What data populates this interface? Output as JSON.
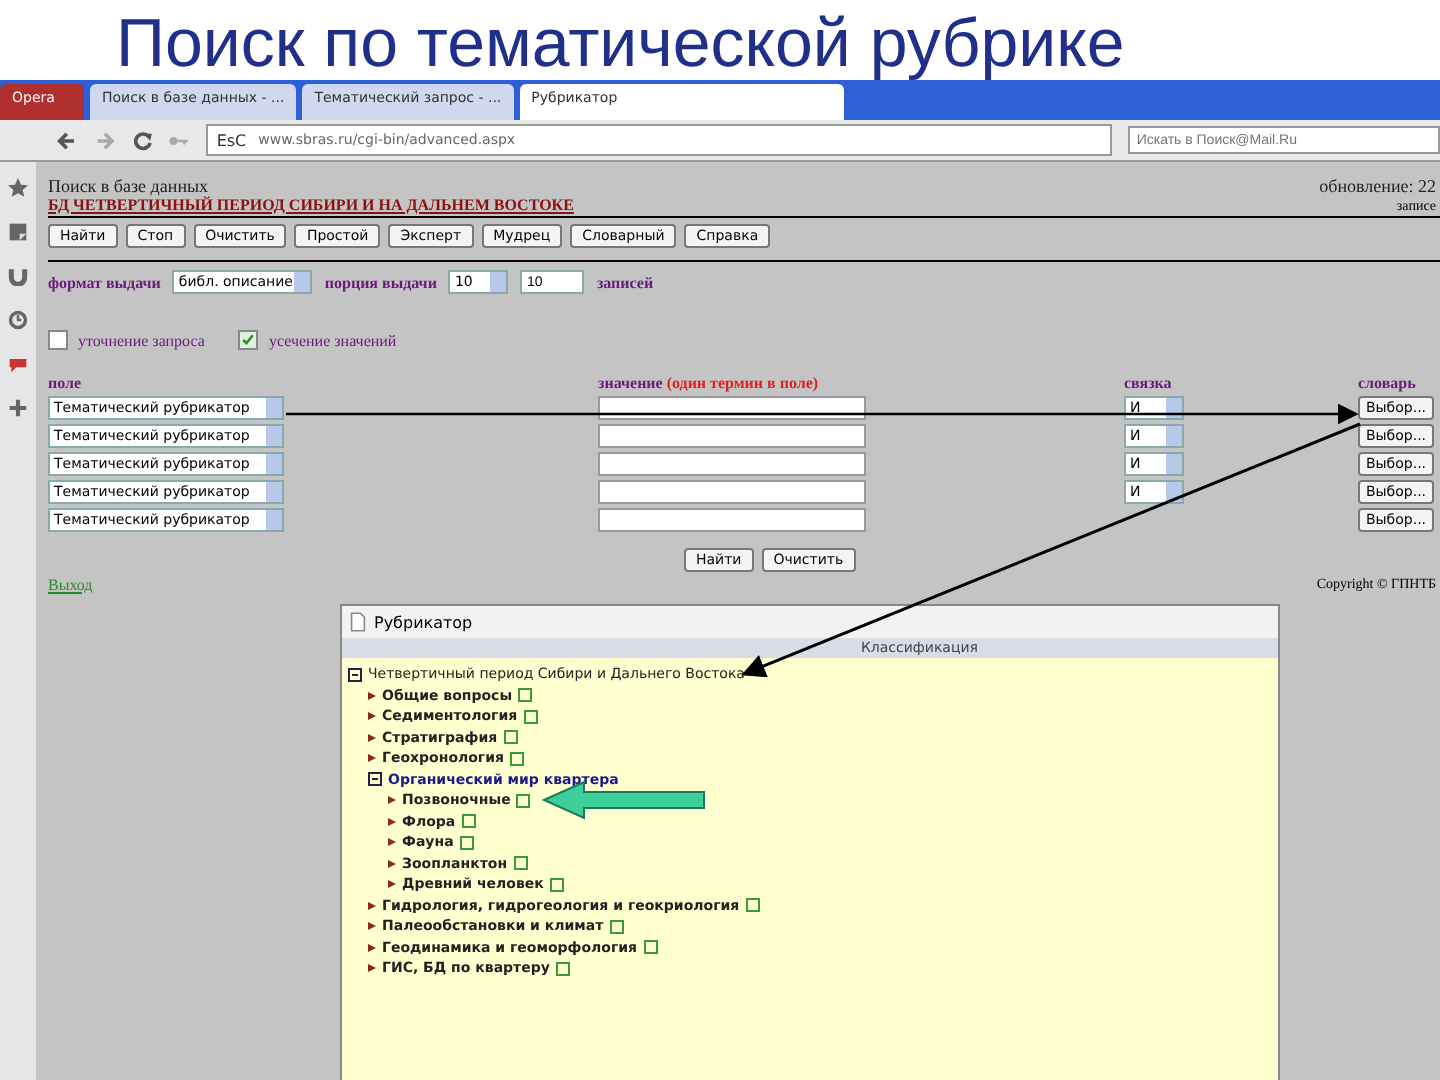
{
  "slide_title": "Поиск по тематической рубрике",
  "browser": {
    "tabs": [
      {
        "label": "Opera",
        "selected": false
      },
      {
        "label": "Поиск в базе данных - ...",
        "selected": false
      },
      {
        "label": "Тематический запрос - ...",
        "selected": false
      },
      {
        "label": "Рубрикатор",
        "selected": true
      }
    ],
    "address": "www.sbras.ru/cgi-bin/advanced.aspx",
    "site_badge": "EsC",
    "search_placeholder": "Искать в Поиск@Mail.Ru"
  },
  "page": {
    "heading": "Поиск в базе данных",
    "db_title": "БД ЧЕТВЕРТИЧНЫЙ ПЕРИОД СИБИРИ И НА ДАЛЬНЕМ ВОСТОКЕ",
    "updated": "обновление: 22",
    "records": "записе",
    "mode_buttons": [
      "Найти",
      "Стоп",
      "Очистить",
      "Простой",
      "Эксперт",
      "Мудрец",
      "Словарный",
      "Справка"
    ],
    "format_label": "формат выдачи",
    "format_value": "библ. описание",
    "portion_label": "порция выдачи",
    "portion_value": "10",
    "portion_input": "10",
    "portion_unit": "записей",
    "options": [
      {
        "label": "уточнение запроса",
        "checked": false
      },
      {
        "label": "усечение значений",
        "checked": true
      }
    ],
    "columns": {
      "field": "поле",
      "value": "значение **(один термин в поле)**",
      "connector": "связка",
      "dictionary": "словарь"
    },
    "rows": [
      {
        "field": "Тематический рубрикатор",
        "connector": "И",
        "dictionary": "Выбор..."
      },
      {
        "field": "Тематический рубрикатор",
        "connector": "И",
        "dictionary": "Выбор..."
      },
      {
        "field": "Тематический рубрикатор",
        "connector": "И",
        "dictionary": "Выбор..."
      },
      {
        "field": "Тематический рубрикатор",
        "connector": "И",
        "dictionary": "Выбор..."
      },
      {
        "field": "Тематический рубрикатор",
        "dictionary": "Выбор..."
      }
    ],
    "submit_buttons": [
      "Найти",
      "Очистить"
    ],
    "back_link": "Выход",
    "copyright": "Copyright © ГПНТБ"
  },
  "popup": {
    "title": "Рубрикатор",
    "header": "Классификация",
    "tree": [
      {
        "label": "Четвертичный период Сибири и Дальнего Востока",
        "expanded": true,
        "children": [
          {
            "label": "Общие вопросы",
            "expanded": false
          },
          {
            "label": "Седиментология",
            "expanded": false
          },
          {
            "label": "Стратиграфия",
            "expanded": false
          },
          {
            "label": "Геохронология",
            "expanded": false
          },
          {
            "label": "Органический мир квартера",
            "expanded": true,
            "children": [
              {
                "label": "Позвоночные",
                "expanded": false
              },
              {
                "label": "Флора",
                "expanded": false
              },
              {
                "label": "Фауна",
                "expanded": false
              },
              {
                "label": "Зоопланктон",
                "expanded": false
              },
              {
                "label": "Древний человек",
                "expanded": false
              }
            ]
          },
          {
            "label": "Гидрология, гидрогеология и геокриология",
            "expanded": false
          },
          {
            "label": "Палеообстановки и климат",
            "expanded": false
          },
          {
            "label": "Геодинамика и геоморфология",
            "expanded": false
          },
          {
            "label": "ГИС, БД по квартеру",
            "expanded": false
          }
        ]
      }
    ]
  }
}
